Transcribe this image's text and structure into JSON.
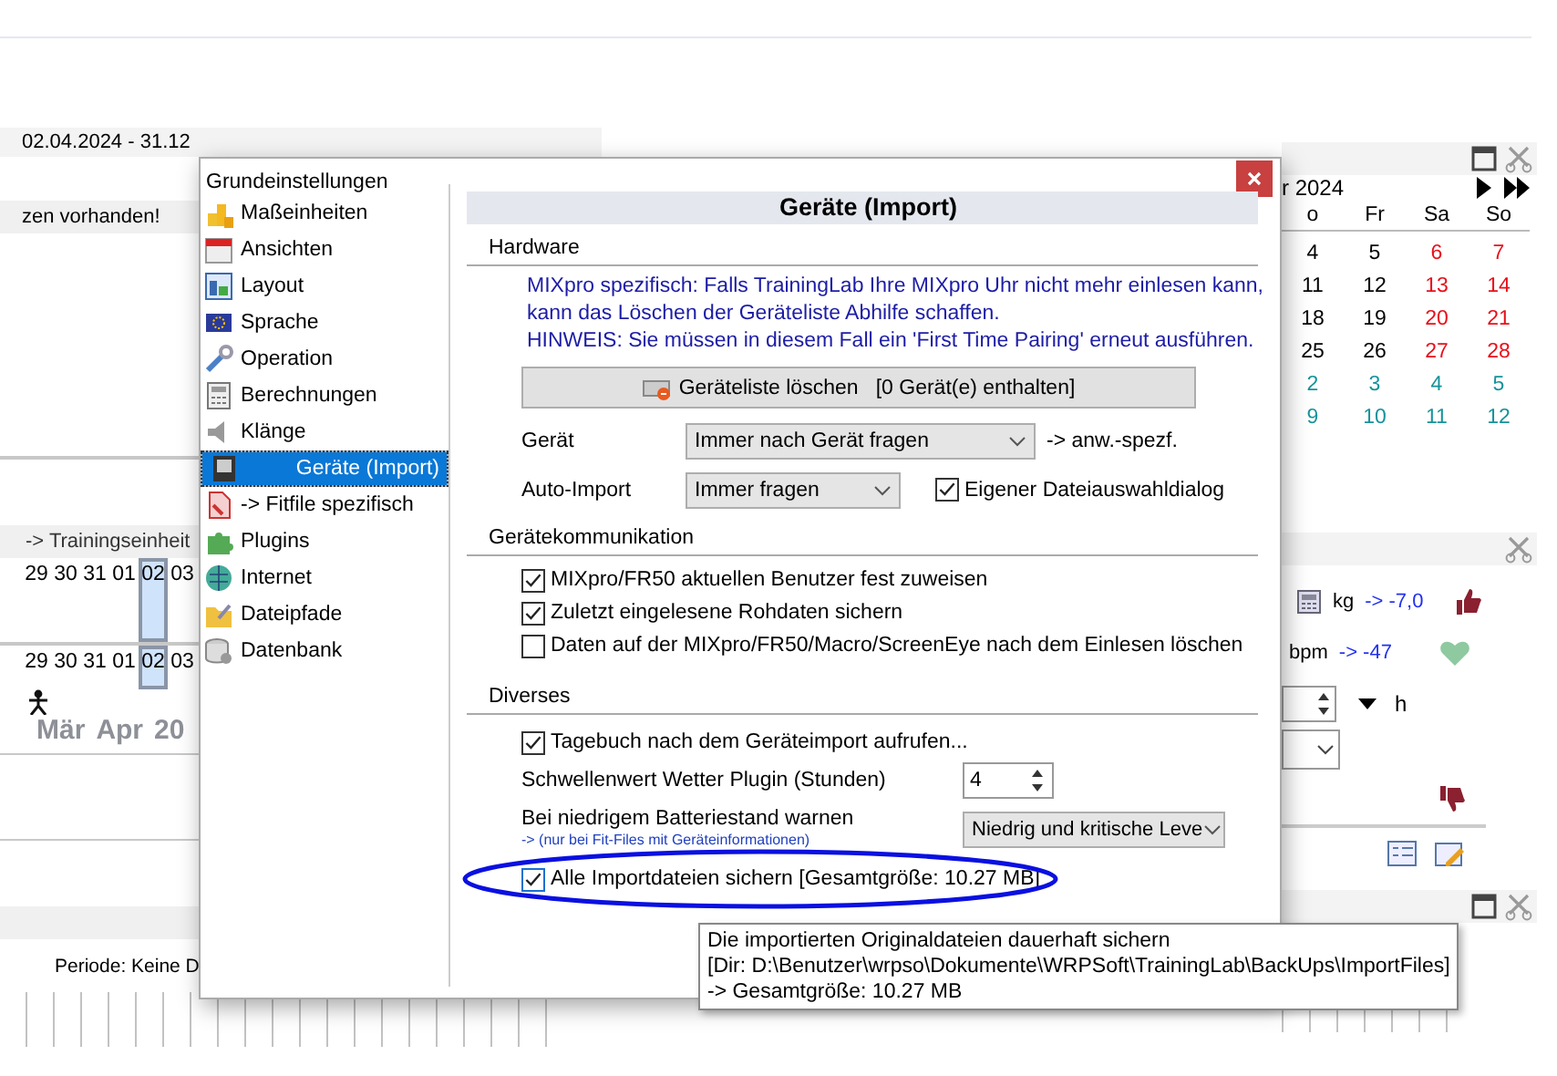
{
  "left_panel": {
    "date_range": "02.04.2024 - 31.12",
    "message": "zen vorhanden!",
    "section": "-> Trainingseinheit",
    "day_rows": [
      [
        {
          "label": "29",
          "selected": false
        },
        {
          "label": "30",
          "selected": false
        },
        {
          "label": "31",
          "selected": false
        },
        {
          "label": "01",
          "selected": false
        },
        {
          "label": "02",
          "selected": true
        },
        {
          "label": "03",
          "selected": false
        }
      ],
      [
        {
          "label": "29",
          "selected": false
        },
        {
          "label": "30",
          "selected": false
        },
        {
          "label": "31",
          "selected": false
        },
        {
          "label": "01",
          "selected": false
        },
        {
          "label": "02",
          "selected": true
        },
        {
          "label": "03",
          "selected": false
        }
      ]
    ],
    "months": [
      "Mär",
      "Apr",
      "20"
    ],
    "period": "Periode: Keine D"
  },
  "right_panel": {
    "month": "r 2024",
    "weekdays": [
      "o",
      "Fr",
      "Sa",
      "So"
    ],
    "weeks": [
      [
        {
          "label": "4",
          "kind": "weekday"
        },
        {
          "label": "5",
          "kind": "weekday"
        },
        {
          "label": "6",
          "kind": "weekend"
        },
        {
          "label": "7",
          "kind": "weekend"
        }
      ],
      [
        {
          "label": "11",
          "kind": "weekday"
        },
        {
          "label": "12",
          "kind": "weekday"
        },
        {
          "label": "13",
          "kind": "weekend"
        },
        {
          "label": "14",
          "kind": "weekend"
        }
      ],
      [
        {
          "label": "18",
          "kind": "weekday"
        },
        {
          "label": "19",
          "kind": "weekday"
        },
        {
          "label": "20",
          "kind": "weekend"
        },
        {
          "label": "21",
          "kind": "weekend"
        }
      ],
      [
        {
          "label": "25",
          "kind": "weekday"
        },
        {
          "label": "26",
          "kind": "weekday"
        },
        {
          "label": "27",
          "kind": "weekend"
        },
        {
          "label": "28",
          "kind": "weekend"
        }
      ],
      [
        {
          "label": "2",
          "kind": "other_month"
        },
        {
          "label": "3",
          "kind": "other_month"
        },
        {
          "label": "4",
          "kind": "other_month"
        },
        {
          "label": "5",
          "kind": "other_month"
        }
      ],
      [
        {
          "label": "9",
          "kind": "other_month"
        },
        {
          "label": "10",
          "kind": "other_month"
        },
        {
          "label": "11",
          "kind": "other_month"
        },
        {
          "label": "12",
          "kind": "other_month"
        }
      ]
    ],
    "weight_unit": "kg",
    "weight_delta": "-> -7,0",
    "pulse_unit": "bpm",
    "pulse_delta": "-> -47",
    "hours_unit": "h"
  },
  "dialog": {
    "title": "Grundeinstellungen",
    "nav": [
      {
        "label": "Maßeinheiten",
        "selected": false
      },
      {
        "label": "Ansichten",
        "selected": false
      },
      {
        "label": "Layout",
        "selected": false
      },
      {
        "label": "Sprache",
        "selected": false
      },
      {
        "label": "Operation",
        "selected": false
      },
      {
        "label": "Berechnungen",
        "selected": false
      },
      {
        "label": "Klänge",
        "selected": false
      },
      {
        "label": "Geräte (Import)",
        "selected": true
      },
      {
        "label": "-> Fitfile spezifisch",
        "selected": false
      },
      {
        "label": "Plugins",
        "selected": false
      },
      {
        "label": "Internet",
        "selected": false
      },
      {
        "label": "Dateipfade",
        "selected": false
      },
      {
        "label": "Datenbank",
        "selected": false
      }
    ],
    "heading": "Geräte (Import)",
    "hardware": {
      "title": "Hardware",
      "info": [
        "MIXpro spezifisch: Falls TrainingLab Ihre MIXpro Uhr nicht mehr einlesen kann,",
        "kann das Löschen der Geräteliste Abhilfe schaffen.",
        "HINWEIS: Sie müssen in diesem Fall ein 'First Time Pairing' erneut ausführen."
      ],
      "clear_button": "Geräteliste löschen",
      "device_count": "[0 Gerät(e) enthalten]",
      "device_label": "Gerät",
      "device_value": "Immer nach Gerät fragen",
      "device_note": "-> anw.-spezf.",
      "auto_import_label": "Auto-Import",
      "auto_import_value": "Immer fragen",
      "own_dialog": {
        "label": "Eigener Dateiauswahldialog",
        "checked": true
      }
    },
    "communication": {
      "title": "Gerätekommunikation",
      "options": [
        {
          "label": "MIXpro/FR50 aktuellen Benutzer fest zuweisen",
          "checked": true
        },
        {
          "label": "Zuletzt eingelesene Rohdaten sichern",
          "checked": true
        },
        {
          "label": "Daten auf der MIXpro/FR50/Macro/ScreenEye nach dem Einlesen löschen",
          "checked": false
        }
      ]
    },
    "misc": {
      "title": "Diverses",
      "diary": {
        "label": "Tagebuch nach dem Geräteimport aufrufen...",
        "checked": true
      },
      "threshold_label": "Schwellenwert Wetter Plugin (Stunden)",
      "threshold_value": "4",
      "battery_label": "Bei niedrigem Batteriestand warnen",
      "battery_note": "-> (nur bei Fit-Files mit Geräteinformationen)",
      "battery_value": "Niedrig und kritische Leve",
      "backup": {
        "label": "Alle Importdateien sichern [Gesamtgröße: 10.27 MB]",
        "checked": true
      }
    }
  },
  "tooltip": [
    "Die importierten Originaldateien dauerhaft sichern",
    "[Dir: D:\\Benutzer\\wrpso\\Dokumente\\WRPSoft\\TrainingLab\\BackUps\\ImportFiles]",
    "-> Gesamtgröße: 10.27 MB"
  ]
}
